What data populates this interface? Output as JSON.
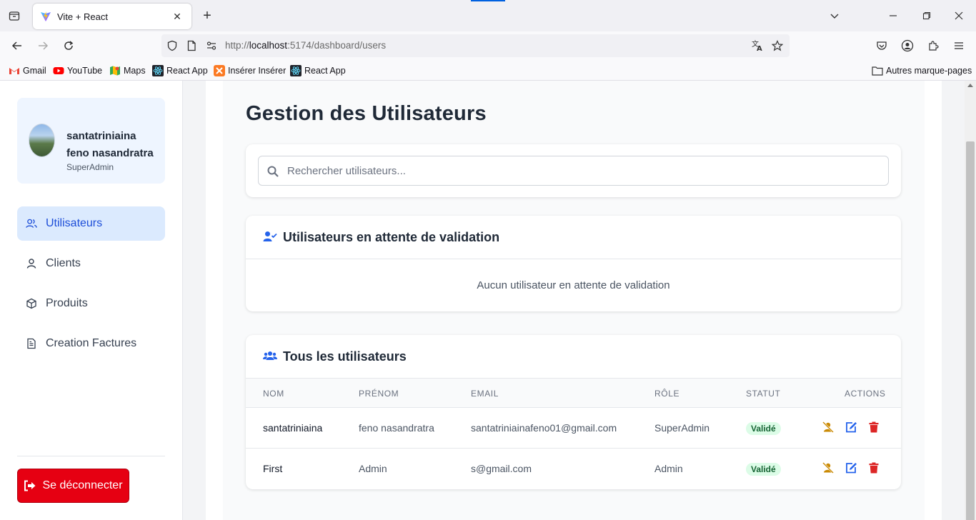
{
  "browser": {
    "tab_title": "Vite + React",
    "url_prefix": "http://",
    "url_host": "localhost",
    "url_rest": ":5174/dashboard/users",
    "bookmarks": [
      {
        "label": "Gmail",
        "icon": "gmail-icon"
      },
      {
        "label": "YouTube",
        "icon": "youtube-icon"
      },
      {
        "label": "Maps",
        "icon": "maps-icon"
      },
      {
        "label": "React App",
        "icon": "react-icon"
      },
      {
        "label": "Insérer Insérer",
        "icon": "xampp-icon"
      },
      {
        "label": "React App",
        "icon": "react-icon"
      }
    ],
    "other_bookmarks": "Autres marque-pages"
  },
  "sidebar": {
    "profile": {
      "name": "santatriniaina feno nasandratra",
      "role": "SuperAdmin"
    },
    "items": [
      {
        "label": "Utilisateurs",
        "icon": "users-icon",
        "active": true
      },
      {
        "label": "Clients",
        "icon": "user-icon",
        "active": false
      },
      {
        "label": "Produits",
        "icon": "box-icon",
        "active": false
      },
      {
        "label": "Creation Factures",
        "icon": "file-invoice-icon",
        "active": false
      }
    ],
    "logout_label": "Se déconnecter"
  },
  "main": {
    "title": "Gestion des Utilisateurs",
    "search_placeholder": "Rechercher utilisateurs...",
    "pending": {
      "title": "Utilisateurs en attente de validation",
      "empty_message": "Aucun utilisateur en attente de validation"
    },
    "all_users": {
      "title": "Tous les utilisateurs",
      "columns": [
        "NOM",
        "PRÉNOM",
        "EMAIL",
        "RÔLE",
        "STATUT",
        "ACTIONS"
      ],
      "rows": [
        {
          "nom": "santatriniaina",
          "prenom": "feno nasandratra",
          "email": "santatriniainafeno01@gmail.com",
          "role": "SuperAdmin",
          "statut": "Validé"
        },
        {
          "nom": "First",
          "prenom": "Admin",
          "email": "s@gmail.com",
          "role": "Admin",
          "statut": "Validé"
        }
      ]
    }
  },
  "colors": {
    "accent": "#2563eb",
    "active_bg": "#dbeafe",
    "logout": "#e60012",
    "badge_bg": "#dcfce7",
    "badge_text": "#166534",
    "action_disable": "#ca8a04",
    "action_delete": "#dc2626"
  }
}
